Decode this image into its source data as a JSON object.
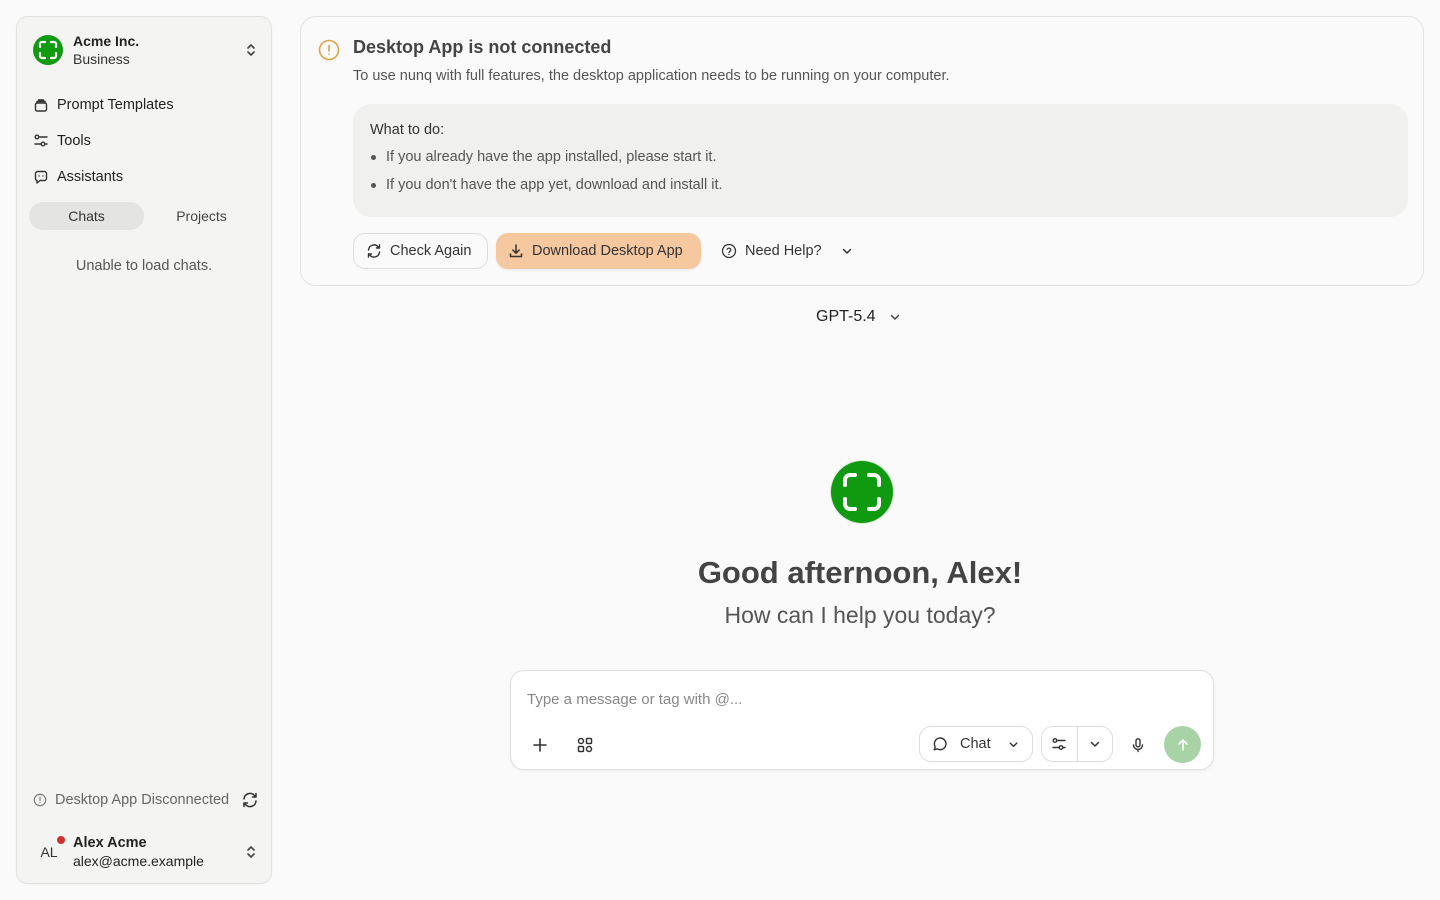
{
  "sidebar": {
    "org": {
      "name": "Acme Inc.",
      "plan": "Business"
    },
    "nav": [
      {
        "label": "Prompt Templates",
        "icon": "template-icon"
      },
      {
        "label": "Tools",
        "icon": "tools-icon"
      },
      {
        "label": "Assistants",
        "icon": "assistant-icon"
      }
    ],
    "tabs": [
      {
        "label": "Chats",
        "active": true
      },
      {
        "label": "Projects",
        "active": false
      }
    ],
    "empty_message": "Unable to load chats.",
    "desktop_status": "Desktop App Disconnected",
    "user": {
      "initials": "AL",
      "name": "Alex Acme",
      "email": "alex@acme.example"
    }
  },
  "alert": {
    "title": "Desktop App is not connected",
    "description": "To use nunq with full features, the desktop application needs to be running on your computer.",
    "todo_title": "What to do:",
    "todo_items": [
      "If you already have the app installed, please start it.",
      "If you don't have the app yet, download and install it."
    ],
    "check_again": "Check Again",
    "download": "Download Desktop App",
    "help": "Need Help?"
  },
  "model": {
    "name": "GPT-5.4"
  },
  "hero": {
    "greeting": "Good afternoon, Alex!",
    "subtitle": "How can I help you today?"
  },
  "composer": {
    "placeholder": "Type a message or tag with @...",
    "mode": "Chat"
  },
  "colors": {
    "brand_green": "#109a10",
    "primary_button": "#f5c8a0",
    "send_button": "#a7d3a7",
    "warning": "#e0a24a",
    "status_dot": "#d03030"
  }
}
